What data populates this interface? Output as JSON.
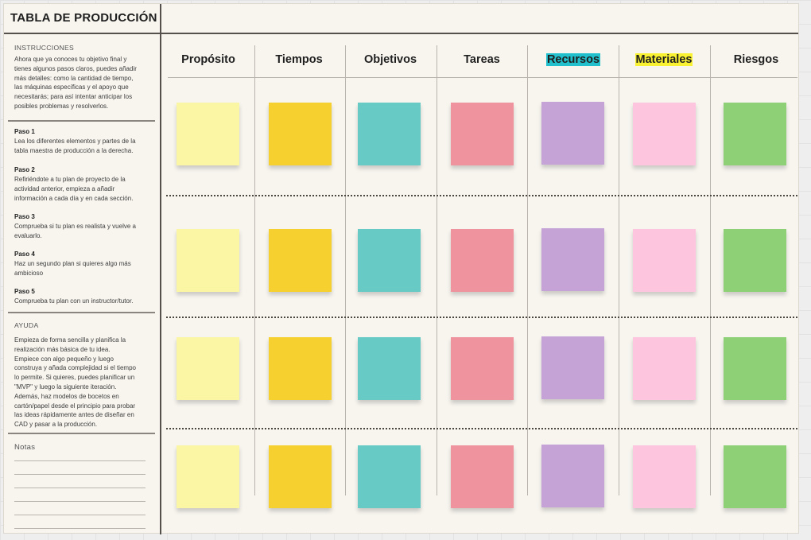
{
  "title": "TABLA DE PRODUCCIÓN",
  "sidebar": {
    "instructions_heading": "INSTRUCCIONES",
    "instructions_lines": [
      "Ahora que ya conoces tu objetivo final y",
      "tienes algunos pasos claros, puedes añadir",
      "más detalles: como la cantidad de tiempo,",
      "las máquinas específicas y el apoyo que",
      "necesitarás; para así intentar anticipar los",
      "posibles problemas y resolverlos."
    ],
    "steps": [
      {
        "title": "Paso 1",
        "lines": [
          "Lea los diferentes elementos y partes de la",
          "tabla maestra de producción a la derecha."
        ]
      },
      {
        "title": "Paso 2",
        "lines": [
          "Refiriéndote a tu plan de proyecto de la",
          "actividad anterior, empieza a añadir",
          "información a cada día y en cada sección."
        ]
      },
      {
        "title": "Paso 3",
        "lines": [
          "Comprueba si tu plan es realista y vuelve a",
          "evaluarlo."
        ]
      },
      {
        "title": "Paso 4",
        "lines": [
          "Haz un segundo plan si quieres algo más",
          "ambicioso"
        ]
      },
      {
        "title": "Paso 5",
        "lines": [
          "Comprueba tu plan con un instructor/tutor."
        ]
      }
    ],
    "help_heading": "AYUDA",
    "help_lines": [
      "Empieza de forma sencilla y planifica la",
      "realización más básica de tu idea.",
      "Empiece con algo pequeño y luego",
      "construya y añada complejidad si el tiempo",
      "lo permite. Si quieres, puedes planificar un",
      "\"MVP\" y luego la siguiente iteración.",
      "Además, haz modelos de bocetos en",
      "cartón/papel desde el principio para probar",
      "las ideas rápidamente antes de diseñar en",
      "CAD y pasar a la producción."
    ],
    "notes_heading": "Notas"
  },
  "columns": [
    {
      "label": "Propósito",
      "sticky_color": "#fbf6a4",
      "highlight": null
    },
    {
      "label": "Tiempos",
      "sticky_color": "#f5d02f",
      "highlight": null
    },
    {
      "label": "Objetivos",
      "sticky_color": "#68cac4",
      "highlight": null
    },
    {
      "label": "Tareas",
      "sticky_color": "#ef949e",
      "highlight": null
    },
    {
      "label": "Recursos",
      "sticky_color": "#c5a3d6",
      "highlight": "#21c0cc"
    },
    {
      "label": "Materiales",
      "sticky_color": "#fdc5de",
      "highlight": "#f9f232"
    },
    {
      "label": "Riesgos",
      "sticky_color": "#8ed075",
      "highlight": null
    }
  ],
  "row_count": 4
}
